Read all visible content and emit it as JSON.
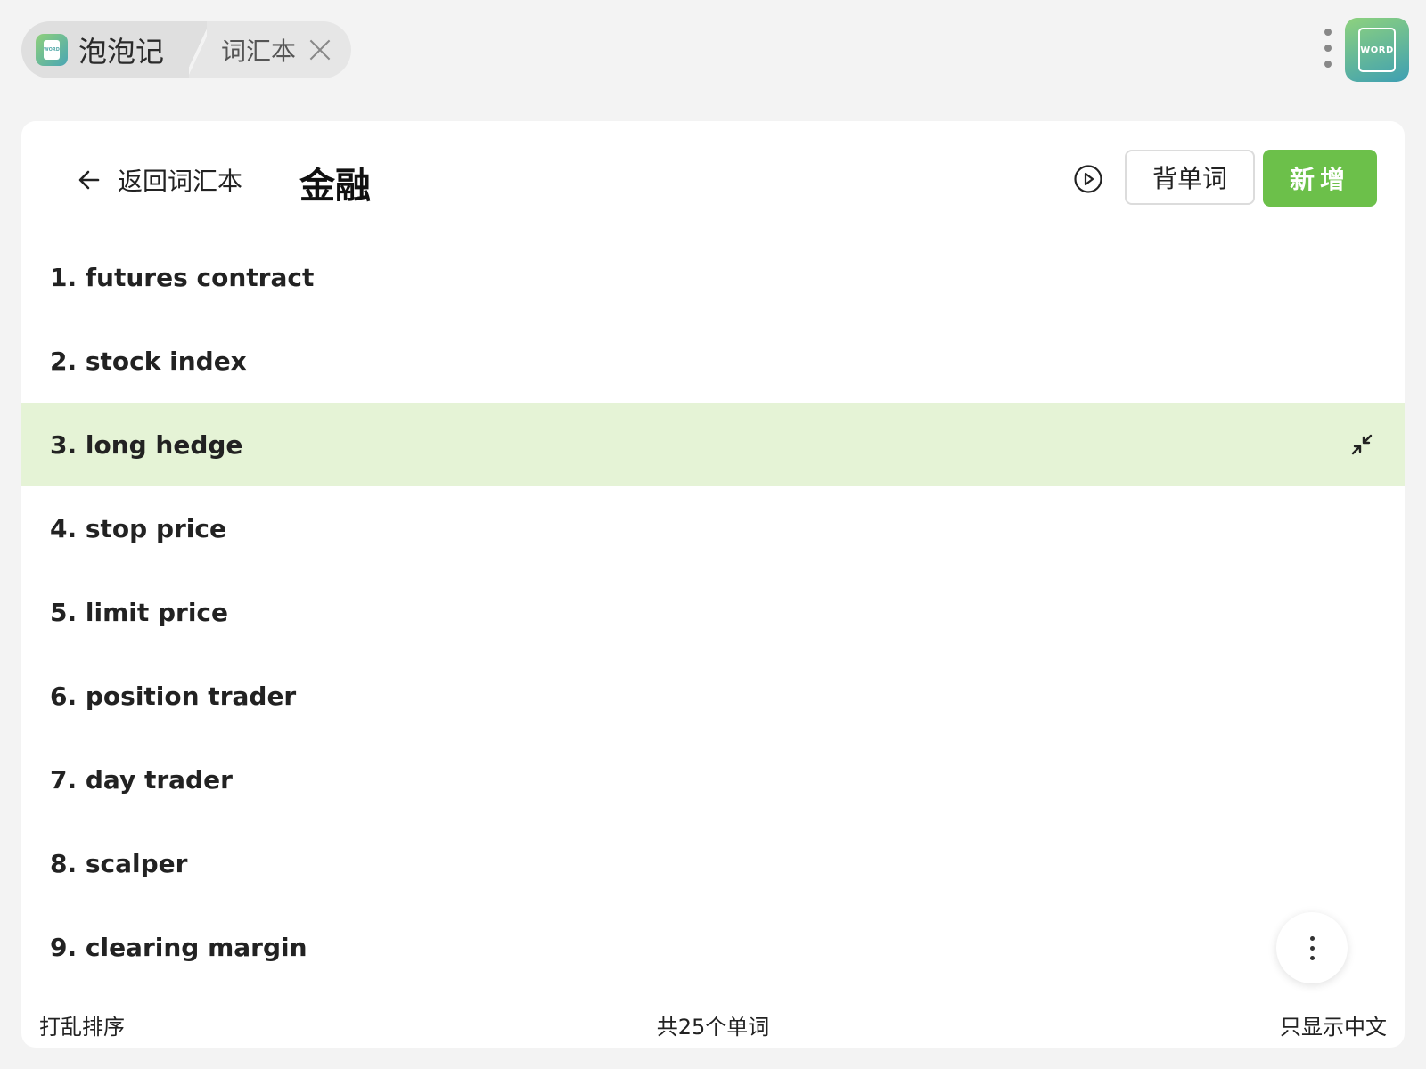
{
  "tabs": {
    "app_label": "泡泡记",
    "current_label": "词汇本",
    "app_icon_text": "WORD"
  },
  "header": {
    "back_label": "返回词汇本",
    "title": "金融",
    "study_button": "背单词",
    "add_button": "新增"
  },
  "words": [
    "1. futures contract",
    "2. stock index",
    "3. long hedge",
    "4. stop price",
    "5. limit price",
    "6. position trader",
    "7. day trader",
    "8. scalper",
    "9. clearing margin"
  ],
  "active_index": 2,
  "footer": {
    "shuffle": "打乱排序",
    "count": "共25个单词",
    "chinese_only": "只显示中文"
  },
  "colors": {
    "accent": "#6cc04a",
    "active_row": "#e5f3d6"
  }
}
